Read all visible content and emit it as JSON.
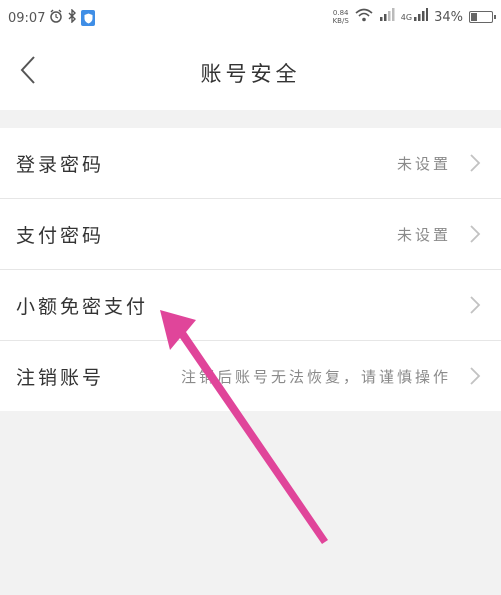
{
  "status_bar": {
    "time": "09:07",
    "net_speed_value": "0.84",
    "net_speed_unit": "KB/S",
    "network_type": "4G",
    "battery": "34%",
    "battery_level": 0.34
  },
  "header": {
    "title": "账号安全"
  },
  "settings": {
    "items": [
      {
        "label": "登录密码",
        "value": "未设置"
      },
      {
        "label": "支付密码",
        "value": "未设置"
      },
      {
        "label": "小额免密支付",
        "value": ""
      },
      {
        "label": "注销账号",
        "value": "注销后账号无法恢复，请谨慎操作"
      }
    ]
  },
  "colors": {
    "background": "#f2f2f2",
    "row_background": "#ffffff",
    "annotation_arrow": "#e0459a"
  }
}
